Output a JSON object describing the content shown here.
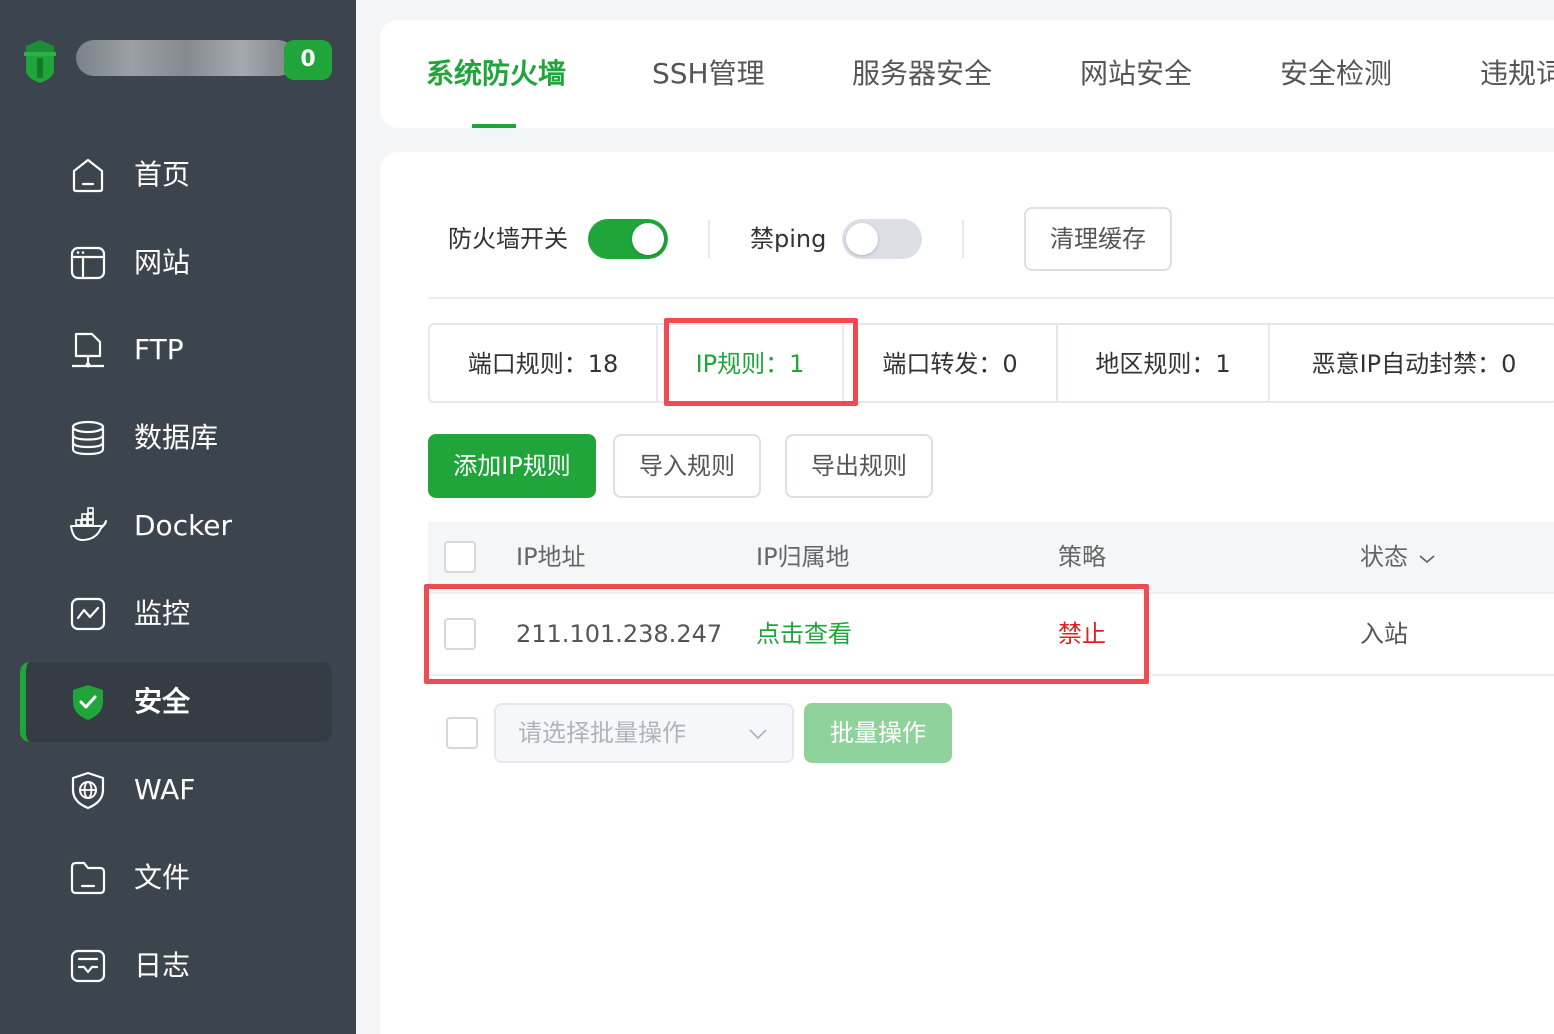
{
  "sidebar": {
    "notification_count": "0",
    "items": [
      {
        "label": "首页",
        "icon": "home-icon"
      },
      {
        "label": "网站",
        "icon": "website-icon"
      },
      {
        "label": "FTP",
        "icon": "ftp-icon"
      },
      {
        "label": "数据库",
        "icon": "database-icon"
      },
      {
        "label": "Docker",
        "icon": "docker-icon"
      },
      {
        "label": "监控",
        "icon": "monitor-icon"
      },
      {
        "label": "安全",
        "icon": "shield-icon",
        "active": true
      },
      {
        "label": "WAF",
        "icon": "waf-icon"
      },
      {
        "label": "文件",
        "icon": "folder-icon"
      },
      {
        "label": "日志",
        "icon": "log-icon"
      }
    ]
  },
  "tabs": [
    {
      "label": "系统防火墙",
      "active": true
    },
    {
      "label": "SSH管理"
    },
    {
      "label": "服务器安全"
    },
    {
      "label": "网站安全"
    },
    {
      "label": "安全检测"
    },
    {
      "label": "违规词"
    }
  ],
  "toolbar": {
    "firewall_label": "防火墙开关",
    "firewall_on": true,
    "ping_label": "禁ping",
    "ping_on": false,
    "clear_cache_label": "清理缓存"
  },
  "stats": [
    {
      "label": "端口规则：18"
    },
    {
      "label": "IP规则：1",
      "active": true
    },
    {
      "label": "端口转发：0"
    },
    {
      "label": "地区规则：1"
    },
    {
      "label": "恶意IP自动封禁：0"
    }
  ],
  "actions": {
    "add_label": "添加IP规则",
    "import_label": "导入规则",
    "export_label": "导出规则"
  },
  "table": {
    "columns": [
      "IP地址",
      "IP归属地",
      "策略",
      "状态"
    ],
    "rows": [
      {
        "ip": "211.101.238.247",
        "location": "点击查看",
        "policy": "禁止",
        "direction": "入站"
      }
    ]
  },
  "batch": {
    "placeholder": "请选择批量操作",
    "button_label": "批量操作"
  },
  "colors": {
    "accent": "#20a53a",
    "sidebar_bg": "#3c444d",
    "danger": "#e02020",
    "highlight": "#ef4b52"
  }
}
